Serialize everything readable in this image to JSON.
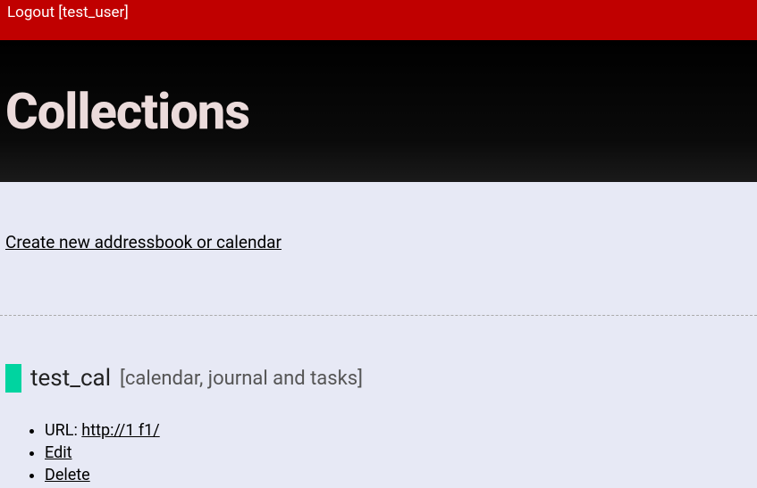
{
  "topbar": {
    "logout_prefix": "Logout [",
    "username": "test_user",
    "logout_suffix": "]"
  },
  "header": {
    "title": "Collections"
  },
  "actions": {
    "create_link": "Create new addressbook or calendar"
  },
  "collection": {
    "color": "#00d4a0",
    "name": "test_cal",
    "type_label": "[calendar, journal and tasks]",
    "url_label": "URL: ",
    "url": "http://1                                                                                                                                                    f1/",
    "edit_label": "Edit",
    "delete_label": "Delete"
  }
}
